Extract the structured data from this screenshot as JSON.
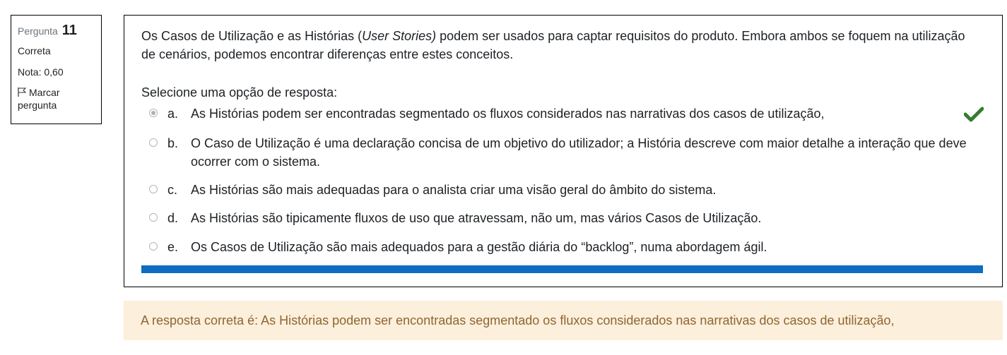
{
  "info": {
    "question_label": "Pergunta",
    "question_number": "11",
    "state": "Correta",
    "grade": "Nota: 0,60",
    "flag_label": "Marcar pergunta"
  },
  "question": {
    "text_before": "Os Casos de Utilização e as Histórias (",
    "text_emphasis": "User Stories)",
    "text_after": " podem ser usados para captar requisitos do produto. Embora ambos se foquem na utilização de cenários, podemos encontrar diferenças entre estes conceitos.",
    "prompt": "Selecione uma opção de resposta:",
    "answers": [
      {
        "letter": "a.",
        "text": "As Histórias podem ser encontradas segmentado os fluxos considerados nas narrativas dos casos de utilização,",
        "selected": true,
        "correct": true
      },
      {
        "letter": "b.",
        "text": "O Caso de Utilização é uma declaração concisa de um objetivo do utilizador; a História descreve com maior detalhe a interação que deve ocorrer com o sistema.",
        "selected": false
      },
      {
        "letter": "c.",
        "text": "As Histórias são mais adequadas para o analista criar uma visão geral do âmbito do sistema.",
        "selected": false
      },
      {
        "letter": "d.",
        "text": "As Histórias são tipicamente fluxos de uso que atravessam, não um, mas vários Casos de Utilização.",
        "selected": false
      },
      {
        "letter": "e.",
        "text": "Os Casos de Utilização são mais adequados para a gestão diária do “backlog”, numa abordagem ágil.",
        "selected": false
      }
    ]
  },
  "feedback": {
    "right_answer": "A resposta correta é: As Histórias podem ser encontradas segmentado os fluxos considerados nas narrativas dos casos de utilização,"
  },
  "colors": {
    "accent": "#0f6cbf",
    "correct_check": "#357a32",
    "feedback_bg": "#fcefdc",
    "feedback_text": "#8e662e"
  },
  "icons": {
    "flag": "flag-icon",
    "correct": "check-icon"
  }
}
